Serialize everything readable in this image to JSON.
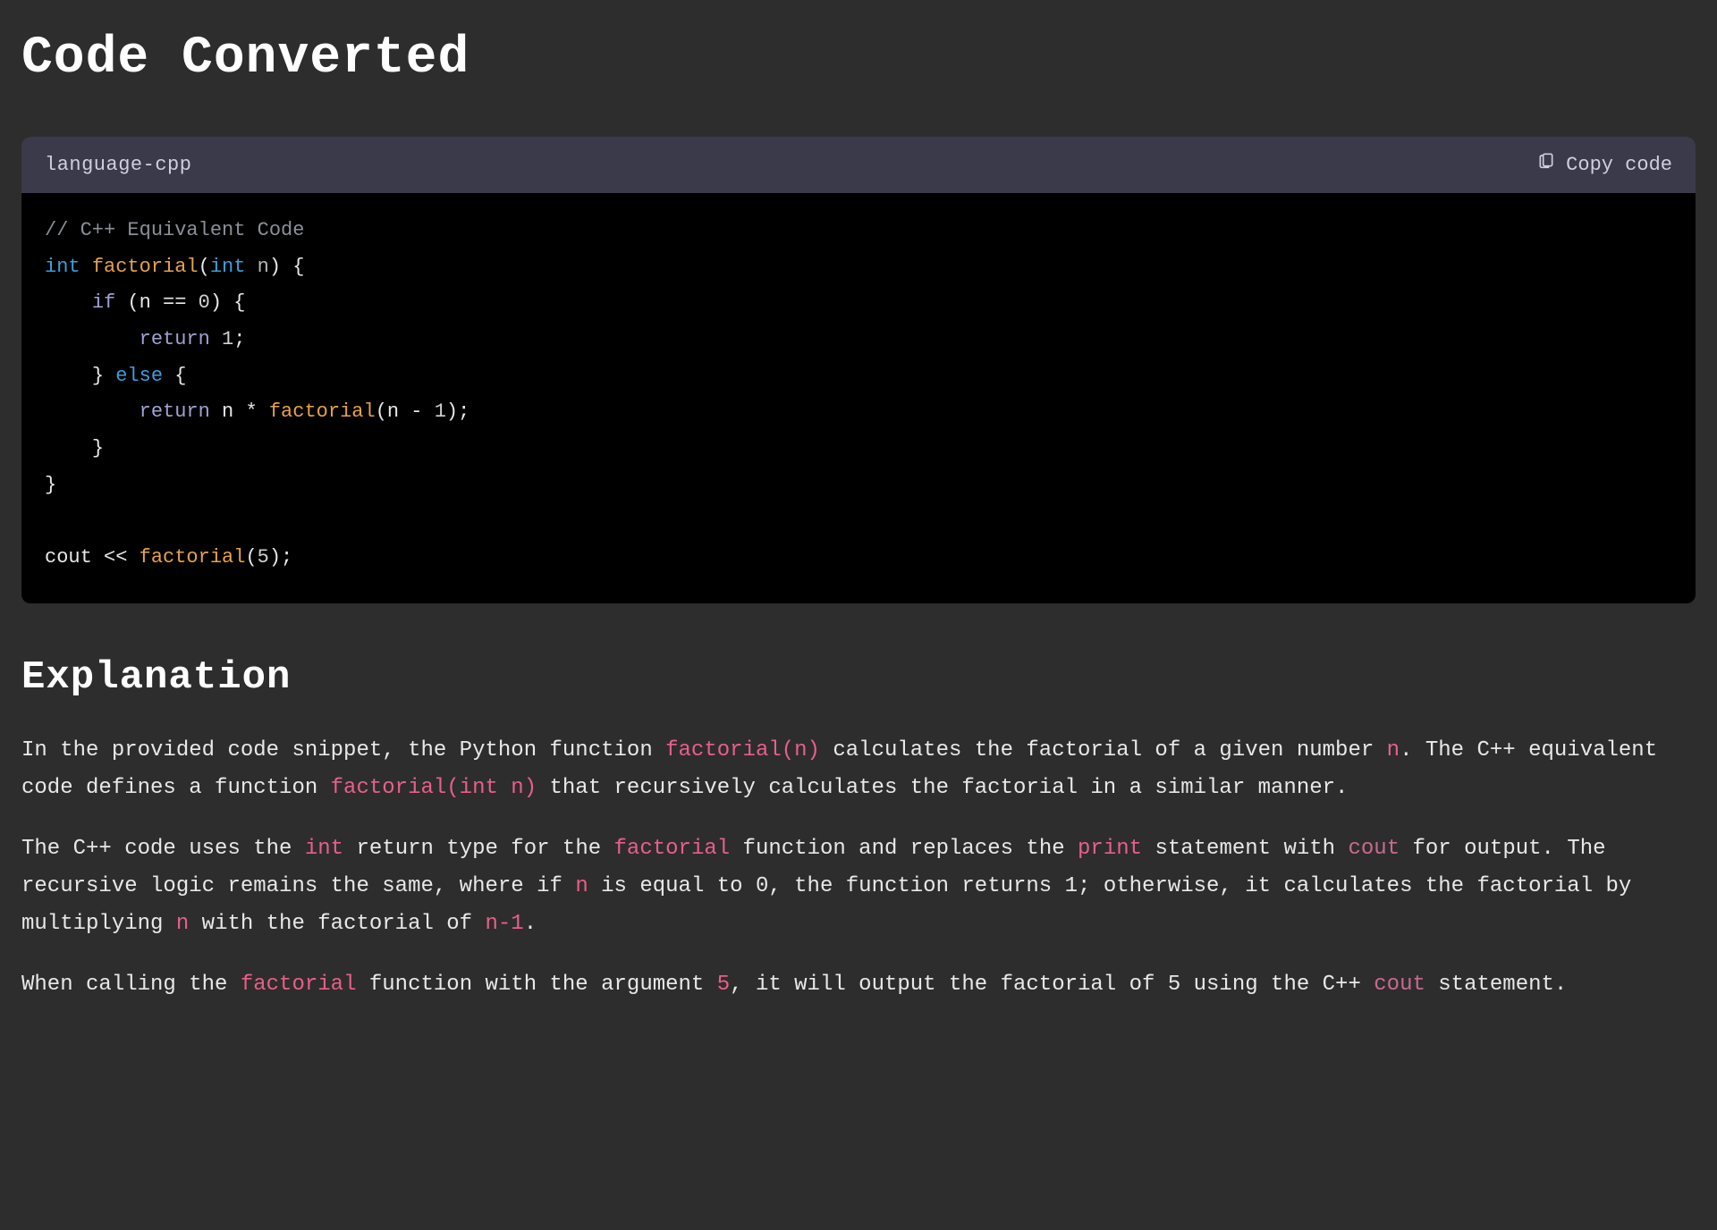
{
  "headings": {
    "title": "Code Converted",
    "explanation": "Explanation"
  },
  "codeBlock": {
    "language": "language-cpp",
    "copyLabel": "Copy code",
    "lines": {
      "l1_comment": "// C++ Equivalent Code",
      "l2_int": "int",
      "l2_fn": "factorial",
      "l2_int2": "int",
      "l2_param": "n",
      "l2_tail": ") {",
      "l3_if": "if",
      "l3_cond": " (n == ",
      "l3_zero": "0",
      "l3_tail": ") {",
      "l4_return": "return",
      "l4_val": " 1",
      "l4_semi": ";",
      "l5_close": "}",
      "l5_else": " else ",
      "l5_open": "{",
      "l6_return": "return",
      "l6_expr1": " n * ",
      "l6_fn": "factorial",
      "l6_expr2": "(n - ",
      "l6_one": "1",
      "l6_tail": ");",
      "l7_close": "}",
      "l8_close": "}",
      "l10_cout": "cout << ",
      "l10_fn": "factorial",
      "l10_arg_open": "(",
      "l10_five": "5",
      "l10_tail": ");"
    }
  },
  "explanation": {
    "p1": {
      "t1": "In the provided code snippet, the Python function ",
      "c1": "factorial(n)",
      "t2": " calculates the factorial of a given number ",
      "c2": "n",
      "t3": ". The C++ equivalent code defines a function ",
      "c3": "factorial(int n)",
      "t4": " that recursively calculates the factorial in a similar manner."
    },
    "p2": {
      "t1": "The C++ code uses the ",
      "c1": "int",
      "t2": " return type for the ",
      "c2": "factorial",
      "t3": " function and replaces the ",
      "c3": "print",
      "t4": " statement with ",
      "c4": "cout",
      "t5": " for output. The recursive logic remains the same, where if ",
      "c5": "n",
      "t6": " is equal to 0, the function returns 1; otherwise, it calculates the factorial by multiplying ",
      "c6": "n",
      "t7": " with the factorial of ",
      "c7": "n-1",
      "t8": "."
    },
    "p3": {
      "t1": "When calling the ",
      "c1": "factorial",
      "t2": " function with the argument ",
      "c2": "5",
      "t3": ", it will output the factorial of 5 using the C++ ",
      "c3": "cout",
      "t4": " statement."
    }
  }
}
